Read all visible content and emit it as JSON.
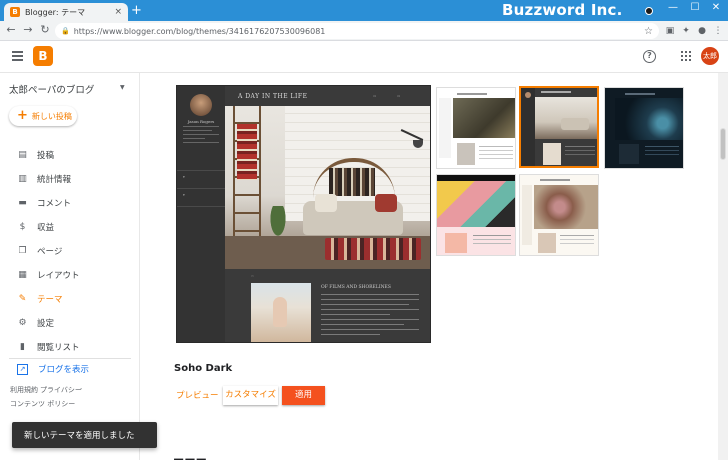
{
  "browser": {
    "tab_title": "Blogger: テーマ",
    "tab_close": "×",
    "new_tab": "+",
    "brand_overlay": "Buzzword Inc.",
    "url": "https://www.blogger.com/blog/themes/3416176207530096081",
    "window_controls": [
      "—",
      "☐",
      "✕"
    ]
  },
  "header": {
    "logo_letter": "B",
    "help_glyph": "?",
    "avatar_label": "太郎"
  },
  "sidebar": {
    "blog_name": "太郎ペーパのブログ",
    "new_post": "新しい投稿",
    "items": [
      {
        "label": "投稿",
        "icon": "posts-icon"
      },
      {
        "label": "統計情報",
        "icon": "stats-icon"
      },
      {
        "label": "コメント",
        "icon": "comments-icon"
      },
      {
        "label": "収益",
        "icon": "earnings-icon"
      },
      {
        "label": "ページ",
        "icon": "pages-icon"
      },
      {
        "label": "レイアウト",
        "icon": "layout-icon"
      },
      {
        "label": "テーマ",
        "icon": "theme-icon",
        "active": true
      },
      {
        "label": "設定",
        "icon": "settings-icon"
      },
      {
        "label": "閲覧リスト",
        "icon": "reading-list-icon"
      }
    ],
    "view_blog": "ブログを表示",
    "footer_links": [
      "利用規約",
      "プライバシー",
      "コンテンツ ポリシー"
    ]
  },
  "main": {
    "preview": {
      "blog_title": "A DAY IN THE LIFE",
      "author": "Jason Rogers",
      "post_title": "OF FILMS AND SHORELINES"
    },
    "theme_name": "Soho Dark",
    "buttons": {
      "preview": "プレビュー",
      "customize": "カスタマイズ",
      "apply": "適用"
    }
  },
  "snackbar": "新しいテーマを適用しました",
  "colors": {
    "accent": "#f57d00",
    "apply_button": "#f4511e",
    "link": "#1a73e8",
    "titlebar": "#2b8fd6"
  }
}
